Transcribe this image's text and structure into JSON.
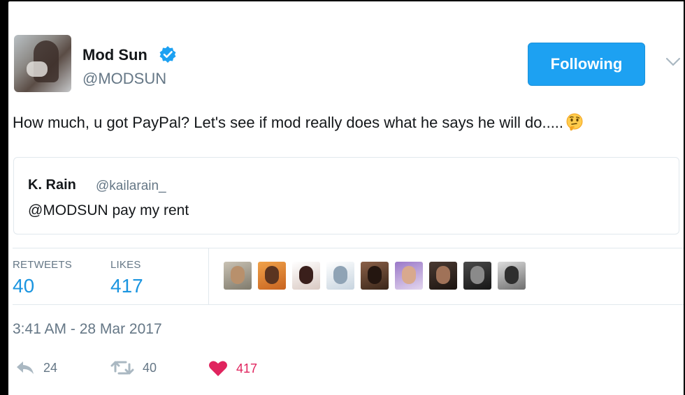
{
  "colors": {
    "accent": "#1da1f2",
    "like": "#e0245e",
    "muted": "#657786",
    "text": "#14171a"
  },
  "author": {
    "name": "Mod Sun",
    "handle": "@MODSUN",
    "verified_icon": "verified-badge-icon",
    "avatar": "avatar"
  },
  "follow_button": {
    "label": "Following"
  },
  "more_menu": {
    "icon": "chevron-down-icon"
  },
  "tweet": {
    "text": "How much, u got PayPal? Let's see if mod really does what he says he will do.....",
    "emoji_icon": "thinking-face-icon"
  },
  "quoted_tweet": {
    "name": "K. Rain",
    "handle": "@kailarain_",
    "text": "@MODSUN pay my rent"
  },
  "stats": {
    "retweets_label": "RETWEETS",
    "retweets_value": "40",
    "likes_label": "LIKES",
    "likes_value": "417"
  },
  "likers_avatars_count": 9,
  "timestamp": "3:41 AM - 28 Mar 2017",
  "actions": {
    "reply_count": "24",
    "retweet_count": "40",
    "like_count": "417"
  }
}
